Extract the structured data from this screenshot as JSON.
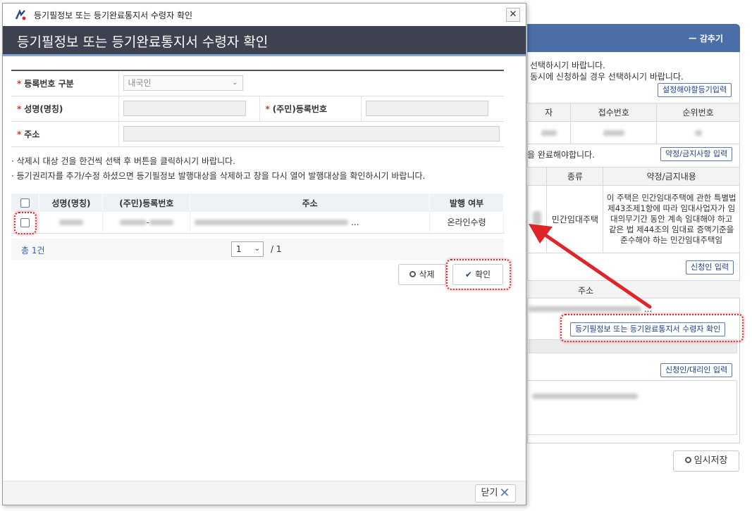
{
  "background": {
    "collapse_label": "ー 감추기",
    "notice_line1": "선택하시기 바랍니다.",
    "notice_line2": "동시에 신청하실 경우 선택하시기 바랍니다.",
    "btn_required_registry": "설정해야할등기입력",
    "table1_headers": [
      "자",
      "접수번호",
      "순위번호"
    ],
    "complete_notice": "을 완료해야합니다.",
    "btn_covenant": "약정/금지사항 입력",
    "table2_headers": [
      "종류",
      "약정/금지내용"
    ],
    "table2_type": "민간임대주택",
    "table2_content": "이 주택은 민간임대주택에 관한 특별법 제43조제1항에 따라 임대사업자가 임대의무기간 동안 계속 임대해야 하고 같은 법 제44조의 임대료 증액기준을 준수해야 하는 민간임대주택임",
    "btn_applicant": "신청인 입력",
    "address_header": "주소",
    "address_tail": "...",
    "btn_recipient_confirm": "등기필정보 또는 등기완료통지서 수령자 확인",
    "btn_applicant_agent": "신청인/대리인 입력",
    "btn_temp_save": "임시저장"
  },
  "modal": {
    "window_title": "등기필정보 또는 등기완료통지서 수령자 확인",
    "header_title": "등기필정보 또는 등기완료통지서 수령자 확인",
    "form": {
      "required_mark": "*",
      "reg_type_label": "등록번호 구분",
      "reg_type_value": "내국인",
      "name_label": "성명(명칭)",
      "id_label": "(주민)등록번호",
      "address_label": "주소"
    },
    "notes": [
      "· 삭제시 대상 건을 한건씩 선택 후 버튼을 클릭하시기 바랍니다.",
      "· 등기권리자를 추가/수정 하셨으면 등기필정보 발행대상을 삭제하고 창을 다시 열어 발행대상을 확인하시기 바랍니다."
    ],
    "table": {
      "headers": [
        "성명(명칭)",
        "(주민)등록번호",
        "주소",
        "발행 여부"
      ],
      "row": {
        "id_separator": "-",
        "address_tail": "...",
        "issue_status": "온라인수령"
      }
    },
    "pager": {
      "total": "총 1건",
      "page": "1",
      "page_total": "/ 1"
    },
    "btn_delete": "삭제",
    "btn_confirm": "확인",
    "btn_close": "닫기"
  },
  "colors": {
    "modal_header": "#3e4250",
    "bg_panel_header": "#4b6ea9",
    "highlight": "#e0242a"
  }
}
